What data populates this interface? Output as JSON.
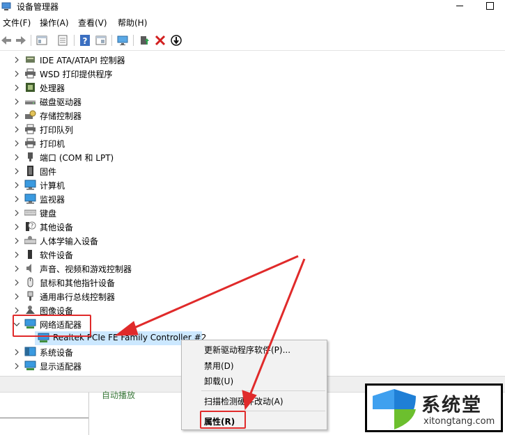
{
  "window": {
    "title": "设备管理器"
  },
  "menu": [
    "文件(F)",
    "操作(A)",
    "查看(V)",
    "帮助(H)"
  ],
  "toolbar": [
    "back-icon",
    "forward-icon",
    "properties-icon",
    "help-icon",
    "scan-icon",
    "monitor-icon",
    "update-driver-icon",
    "uninstall-icon",
    "disable-icon"
  ],
  "tree": {
    "items": [
      {
        "label": "IDE ATA/ATAPI 控制器",
        "icon": "ide-controller-icon"
      },
      {
        "label": "WSD 打印提供程序",
        "icon": "printer-icon"
      },
      {
        "label": "处理器",
        "icon": "processor-icon"
      },
      {
        "label": "磁盘驱动器",
        "icon": "disk-icon"
      },
      {
        "label": "存储控制器",
        "icon": "storage-controller-icon"
      },
      {
        "label": "打印队列",
        "icon": "printer-icon"
      },
      {
        "label": "打印机",
        "icon": "printer-icon"
      },
      {
        "label": "端口 (COM 和 LPT)",
        "icon": "port-icon"
      },
      {
        "label": "固件",
        "icon": "firmware-icon"
      },
      {
        "label": "计算机",
        "icon": "computer-icon"
      },
      {
        "label": "监视器",
        "icon": "monitor-icon"
      },
      {
        "label": "键盘",
        "icon": "keyboard-icon"
      },
      {
        "label": "其他设备",
        "icon": "unknown-device-icon"
      },
      {
        "label": "人体学输入设备",
        "icon": "hid-icon"
      },
      {
        "label": "软件设备",
        "icon": "software-device-icon"
      },
      {
        "label": "声音、视频和游戏控制器",
        "icon": "speaker-icon"
      },
      {
        "label": "鼠标和其他指针设备",
        "icon": "mouse-icon"
      },
      {
        "label": "通用串行总线控制器",
        "icon": "usb-icon"
      },
      {
        "label": "图像设备",
        "icon": "camera-icon"
      },
      {
        "label": "网络适配器",
        "icon": "network-adapter-icon"
      },
      {
        "label": "Realtek PCIe FE Family Controller #2",
        "icon": "network-adapter-icon"
      },
      {
        "label": "系统设备",
        "icon": "system-device-icon"
      },
      {
        "label": "显示适配器",
        "icon": "display-adapter-icon"
      }
    ]
  },
  "context_menu": {
    "update_driver": "更新驱动程序软件(P)...",
    "disable": "禁用(D)",
    "uninstall": "卸载(U)",
    "scan": "扫描检测硬件改动(A)",
    "properties": "属性(R)"
  },
  "background_text": "自动播放",
  "watermark": {
    "brand": "系统堂",
    "url": "xitongtang.com"
  },
  "colors": {
    "annotation": "#e02a2a",
    "menu_bg": "#f2f2f2",
    "selection": "#cce8ff",
    "watermark_blue": "#1f7fd6",
    "watermark_green": "#6cbf2e"
  }
}
